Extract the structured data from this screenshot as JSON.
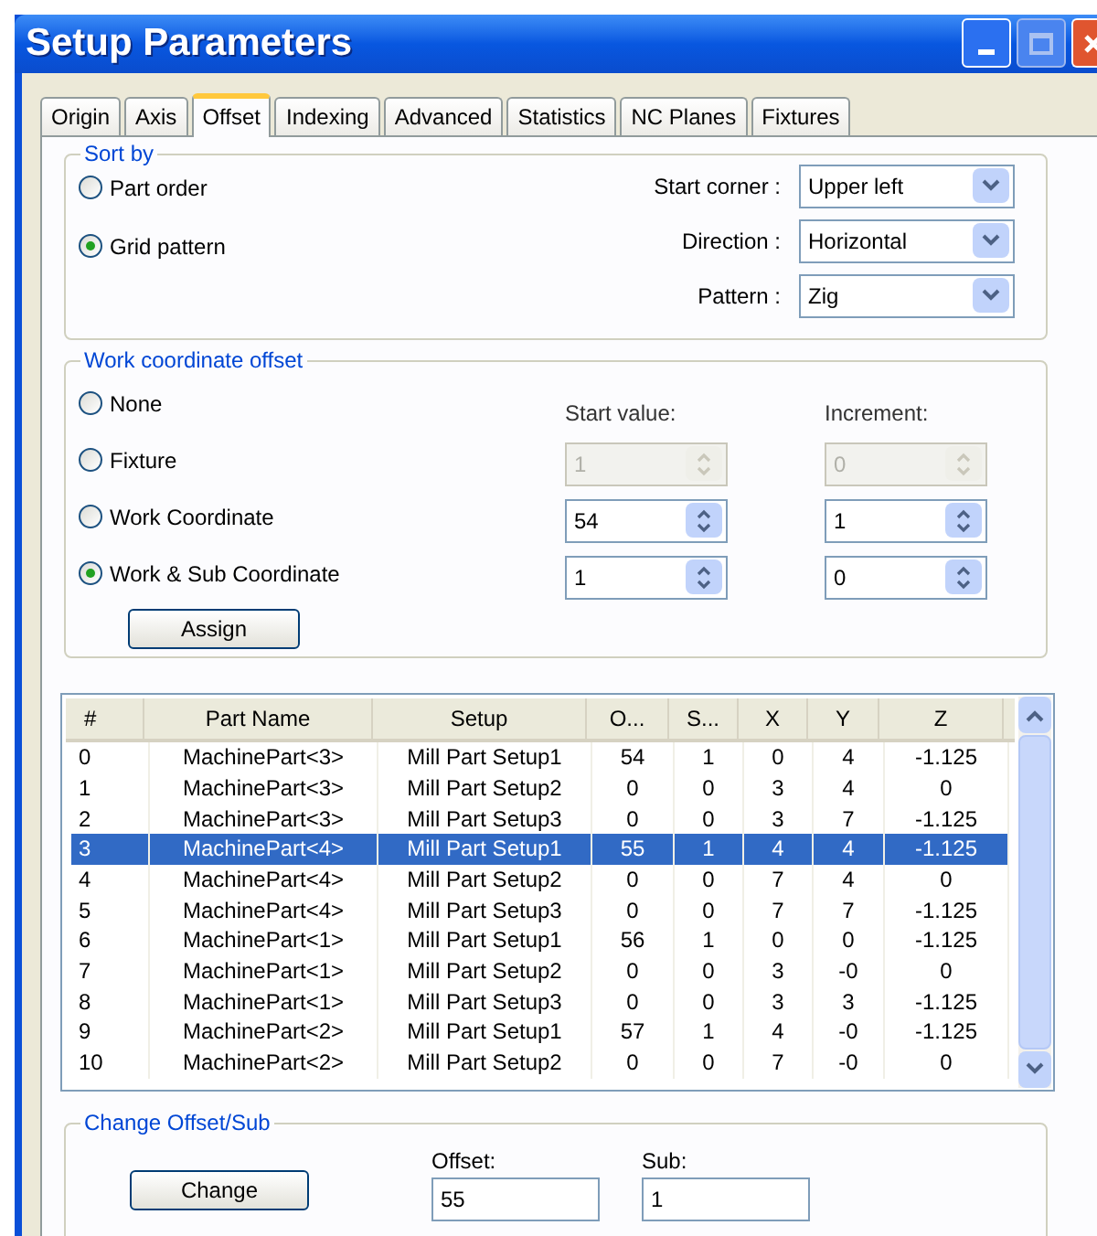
{
  "window": {
    "title": "Setup Parameters"
  },
  "tabs": [
    {
      "label": "Origin",
      "selected": false
    },
    {
      "label": "Axis",
      "selected": false
    },
    {
      "label": "Offset",
      "selected": true
    },
    {
      "label": "Indexing",
      "selected": false
    },
    {
      "label": "Advanced",
      "selected": false
    },
    {
      "label": "Statistics",
      "selected": false
    },
    {
      "label": "NC Planes",
      "selected": false
    },
    {
      "label": "Fixtures",
      "selected": false
    }
  ],
  "sort_by": {
    "title": "Sort by",
    "options": [
      {
        "label": "Part order",
        "selected": false
      },
      {
        "label": "Grid pattern",
        "selected": true
      }
    ],
    "dropdowns": [
      {
        "label": "Start corner :",
        "value": "Upper left"
      },
      {
        "label": "Direction :",
        "value": "Horizontal"
      },
      {
        "label": "Pattern :",
        "value": "Zig"
      }
    ]
  },
  "work_coordinate_offset": {
    "title": "Work coordinate offset",
    "start_label": "Start value:",
    "increment_label": "Increment:",
    "options": [
      {
        "label": "None",
        "selected": false
      },
      {
        "label": "Fixture",
        "selected": false,
        "start": {
          "value": "1",
          "disabled": true
        },
        "increment": {
          "value": "0",
          "disabled": true
        }
      },
      {
        "label": "Work Coordinate",
        "selected": false,
        "start": {
          "value": "54",
          "disabled": false
        },
        "increment": {
          "value": "1",
          "disabled": false
        }
      },
      {
        "label": "Work & Sub Coordinate",
        "selected": true,
        "start": {
          "value": "1",
          "disabled": false
        },
        "increment": {
          "value": "0",
          "disabled": false
        }
      }
    ],
    "assign_button": "Assign"
  },
  "table": {
    "columns": [
      "#",
      "Part Name",
      "Setup",
      "O...",
      "S...",
      "X",
      "Y",
      "Z"
    ],
    "rows": [
      {
        "selected": false,
        "cells": [
          "0",
          "MachinePart<3>",
          "Mill Part Setup1",
          "54",
          "1",
          "0",
          "4",
          "-1.125"
        ]
      },
      {
        "selected": false,
        "cells": [
          "1",
          "MachinePart<3>",
          "Mill Part Setup2",
          "0",
          "0",
          "3",
          "4",
          "0"
        ]
      },
      {
        "selected": false,
        "cells": [
          "2",
          "MachinePart<3>",
          "Mill Part Setup3",
          "0",
          "0",
          "3",
          "7",
          "-1.125"
        ]
      },
      {
        "selected": true,
        "cells": [
          "3",
          "MachinePart<4>",
          "Mill Part Setup1",
          "55",
          "1",
          "4",
          "4",
          "-1.125"
        ]
      },
      {
        "selected": false,
        "cells": [
          "4",
          "MachinePart<4>",
          "Mill Part Setup2",
          "0",
          "0",
          "7",
          "4",
          "0"
        ]
      },
      {
        "selected": false,
        "cells": [
          "5",
          "MachinePart<4>",
          "Mill Part Setup3",
          "0",
          "0",
          "7",
          "7",
          "-1.125"
        ]
      },
      {
        "selected": false,
        "cells": [
          "6",
          "MachinePart<1>",
          "Mill Part Setup1",
          "56",
          "1",
          "0",
          "0",
          "-1.125"
        ]
      },
      {
        "selected": false,
        "cells": [
          "7",
          "MachinePart<1>",
          "Mill Part Setup2",
          "0",
          "0",
          "3",
          "-0",
          "0"
        ]
      },
      {
        "selected": false,
        "cells": [
          "8",
          "MachinePart<1>",
          "Mill Part Setup3",
          "0",
          "0",
          "3",
          "3",
          "-1.125"
        ]
      },
      {
        "selected": false,
        "cells": [
          "9",
          "MachinePart<2>",
          "Mill Part Setup1",
          "57",
          "1",
          "4",
          "-0",
          "-1.125"
        ]
      },
      {
        "selected": false,
        "cells": [
          "10",
          "MachinePart<2>",
          "Mill Part Setup2",
          "0",
          "0",
          "7",
          "-0",
          "0"
        ]
      }
    ]
  },
  "change_offset_sub": {
    "title": "Change Offset/Sub",
    "button": "Change",
    "fields": [
      {
        "label": "Offset:",
        "value": "55"
      },
      {
        "label": "Sub:",
        "value": "1"
      }
    ]
  }
}
